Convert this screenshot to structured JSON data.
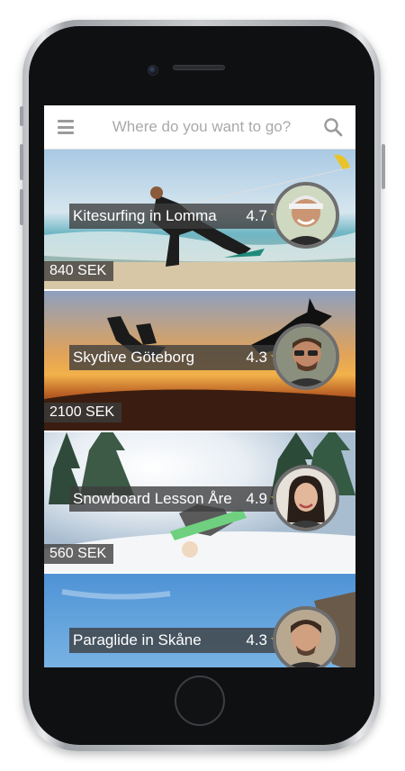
{
  "search": {
    "placeholder": "Where do you want to go?"
  },
  "icons": {
    "menu": "menu-icon",
    "search": "search-icon",
    "rating": "star-icon"
  },
  "colors": {
    "star": "#f5c518",
    "overlay": "#3c3c3c"
  },
  "activities": [
    {
      "title": "Kitesurfing in Lomma",
      "rating": "4.7",
      "star": "★",
      "price": "840 SEK"
    },
    {
      "title": "Skydive Göteborg",
      "rating": "4.3",
      "star": "★",
      "price": "2100 SEK"
    },
    {
      "title": "Snowboard Lesson Åre",
      "rating": "4.9",
      "star": "★",
      "price": "560 SEK"
    },
    {
      "title": "Paraglide in Skåne",
      "rating": "4.3",
      "star": "★",
      "price": ""
    }
  ]
}
